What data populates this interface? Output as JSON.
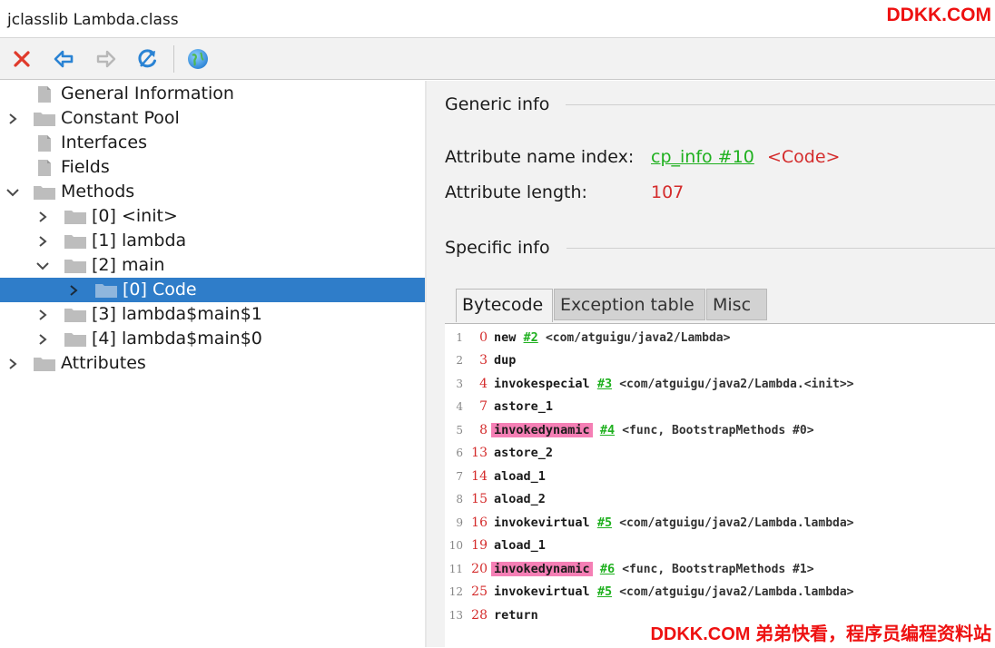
{
  "window": {
    "title": "jclasslib Lambda.class"
  },
  "watermarks": {
    "top": "DDKK.COM",
    "bottom": "DDKK.COM 弟弟快看，程序员编程资料站"
  },
  "toolbar": {
    "buttons": [
      {
        "name": "close-icon",
        "color": "#e03a2b"
      },
      {
        "name": "back-icon",
        "color": "#2a83d4"
      },
      {
        "name": "forward-icon",
        "color": "#b8b8b8"
      },
      {
        "name": "reload-icon",
        "color": "#2a83d4"
      },
      {
        "name": "browser-icon",
        "color": "#3b96e0"
      }
    ]
  },
  "tree": {
    "items": [
      {
        "label": "General Information",
        "depth": 0,
        "expander": "none",
        "icon": "file-icon"
      },
      {
        "label": "Constant Pool",
        "depth": 0,
        "expander": "collapsed",
        "icon": "folder-icon"
      },
      {
        "label": "Interfaces",
        "depth": 0,
        "expander": "none",
        "icon": "file-icon"
      },
      {
        "label": "Fields",
        "depth": 0,
        "expander": "none",
        "icon": "file-icon"
      },
      {
        "label": "Methods",
        "depth": 0,
        "expander": "expanded",
        "icon": "folder-icon"
      },
      {
        "label": "[0] <init>",
        "depth": 1,
        "expander": "collapsed",
        "icon": "folder-icon"
      },
      {
        "label": "[1] lambda",
        "depth": 1,
        "expander": "collapsed",
        "icon": "folder-icon"
      },
      {
        "label": "[2] main",
        "depth": 1,
        "expander": "expanded",
        "icon": "folder-icon"
      },
      {
        "label": "[0] Code",
        "depth": 2,
        "expander": "collapsed",
        "icon": "folder-icon",
        "selected": true
      },
      {
        "label": "[3] lambda$main$1",
        "depth": 1,
        "expander": "collapsed",
        "icon": "folder-icon"
      },
      {
        "label": "[4] lambda$main$0",
        "depth": 1,
        "expander": "collapsed",
        "icon": "folder-icon"
      },
      {
        "label": "Attributes",
        "depth": 0,
        "expander": "collapsed",
        "icon": "folder-icon"
      }
    ]
  },
  "generic": {
    "heading": "Generic info",
    "name_index_label": "Attribute name index:",
    "name_index_link": "cp_info #10",
    "name_index_value": "<Code>",
    "length_label": "Attribute length:",
    "length_value": "107"
  },
  "specific": {
    "heading": "Specific info"
  },
  "tabs": [
    {
      "label": "Bytecode",
      "active": true
    },
    {
      "label": "Exception table",
      "active": false
    },
    {
      "label": "Misc",
      "active": false
    }
  ],
  "bytecode": [
    {
      "line": "1",
      "offset": "0",
      "op": "new",
      "ref": "#2",
      "comment": "<com/atguigu/java2/Lambda>"
    },
    {
      "line": "2",
      "offset": "3",
      "op": "dup",
      "ref": "",
      "comment": ""
    },
    {
      "line": "3",
      "offset": "4",
      "op": "invokespecial",
      "ref": "#3",
      "comment": "<com/atguigu/java2/Lambda.<init>>"
    },
    {
      "line": "4",
      "offset": "7",
      "op": "astore_1",
      "ref": "",
      "comment": ""
    },
    {
      "line": "5",
      "offset": "8",
      "op": "invokedynamic",
      "ref": "#4",
      "comment": "<func, BootstrapMethods #0>",
      "highlight": true
    },
    {
      "line": "6",
      "offset": "13",
      "op": "astore_2",
      "ref": "",
      "comment": ""
    },
    {
      "line": "7",
      "offset": "14",
      "op": "aload_1",
      "ref": "",
      "comment": ""
    },
    {
      "line": "8",
      "offset": "15",
      "op": "aload_2",
      "ref": "",
      "comment": ""
    },
    {
      "line": "9",
      "offset": "16",
      "op": "invokevirtual",
      "ref": "#5",
      "comment": "<com/atguigu/java2/Lambda.lambda>"
    },
    {
      "line": "10",
      "offset": "19",
      "op": "aload_1",
      "ref": "",
      "comment": ""
    },
    {
      "line": "11",
      "offset": "20",
      "op": "invokedynamic",
      "ref": "#6",
      "comment": "<func, BootstrapMethods #1>",
      "highlight": true
    },
    {
      "line": "12",
      "offset": "25",
      "op": "invokevirtual",
      "ref": "#5",
      "comment": "<com/atguigu/java2/Lambda.lambda>"
    },
    {
      "line": "13",
      "offset": "28",
      "op": "return",
      "ref": "",
      "comment": ""
    }
  ],
  "colors": {
    "selection": "#2f7dc9",
    "link": "#1fb01f",
    "value_red": "#d42c2c",
    "highlight_pink": "#f57fb5",
    "watermark_red": "#ee1111"
  }
}
